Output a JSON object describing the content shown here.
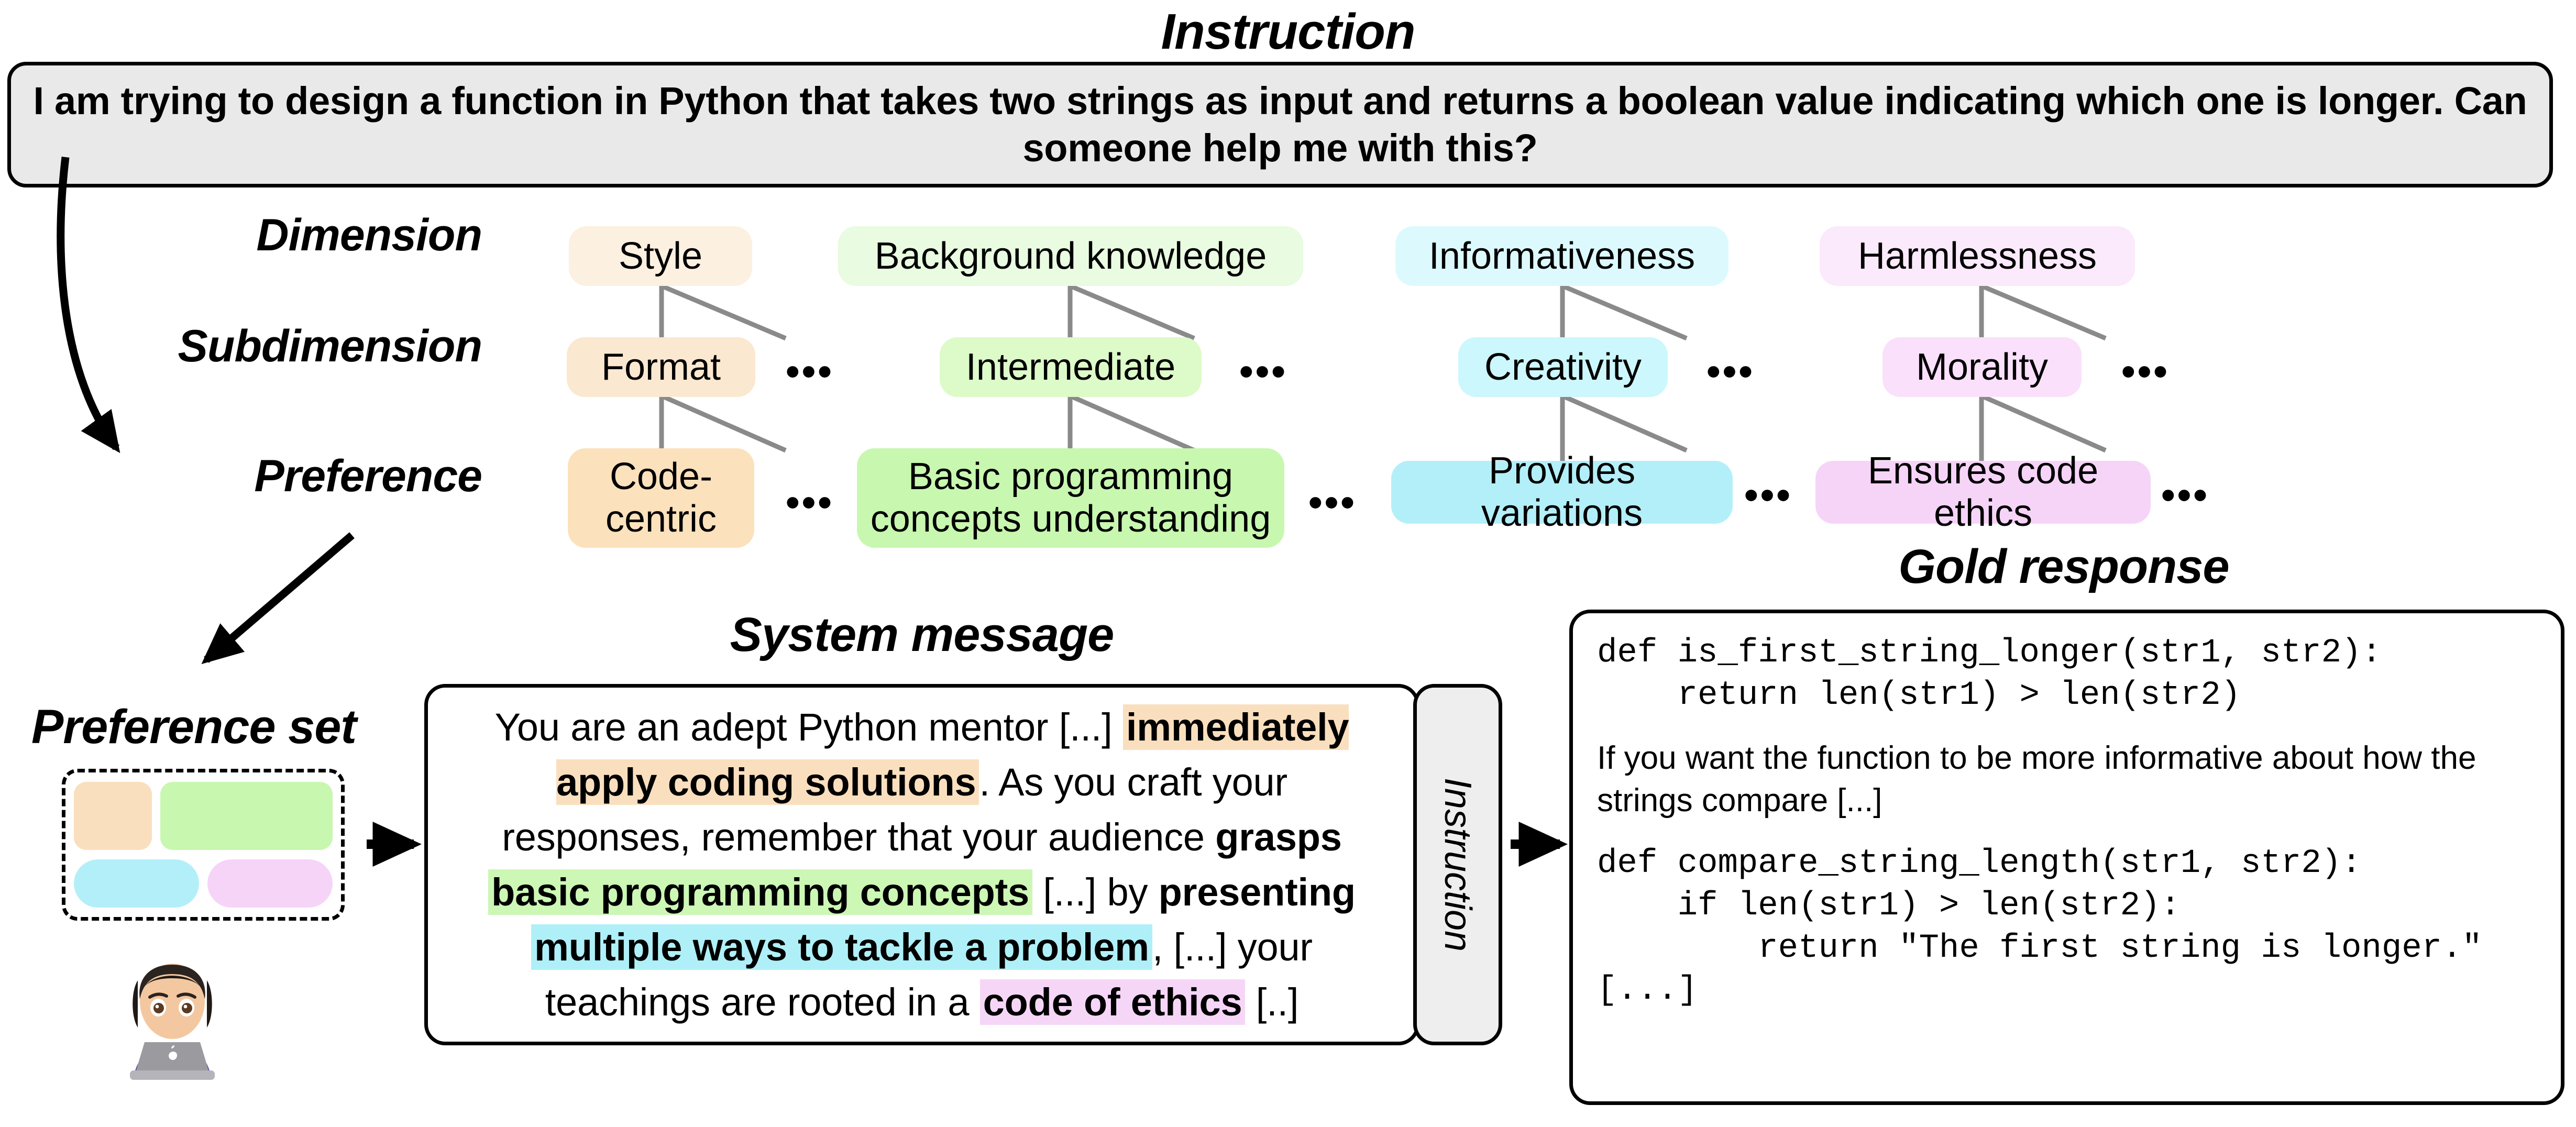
{
  "titles": {
    "instruction": "Instruction",
    "system_message": "System message",
    "gold_response": "Gold response",
    "preference_set": "Preference set"
  },
  "row_labels": {
    "dimension": "Dimension",
    "subdimension": "Subdimension",
    "preference": "Preference"
  },
  "instruction": {
    "text": "I am trying to design a function in Python that takes two strings as input and returns a boolean value indicating which one is longer. Can someone help me with this?"
  },
  "taxonomy": {
    "ellipsis": "•••",
    "columns": [
      {
        "key": "style",
        "color_dimension": "#fcf0e1",
        "color_subdimension": "#fbe8d0",
        "color_preference": "#fbe1bc",
        "dimension": "Style",
        "subdimension": "Format",
        "preference": "Code-\ncentric"
      },
      {
        "key": "background-knowledge",
        "color_dimension": "#e9fbe0",
        "color_subdimension": "#ddfac9",
        "color_preference": "#c8f7b0",
        "dimension": "Background knowledge",
        "subdimension": "Intermediate",
        "preference": "Basic programming\nconcepts understanding"
      },
      {
        "key": "informativeness",
        "color_dimension": "#dcfafd",
        "color_subdimension": "#ccf7fc",
        "color_preference": "#b3eff9",
        "dimension": "Informativeness",
        "subdimension": "Creativity",
        "preference": "Provides variations"
      },
      {
        "key": "harmlessness",
        "color_dimension": "#fbeafb",
        "color_subdimension": "#fae0fb",
        "color_preference": "#f6d4f8",
        "dimension": "Harmlessness",
        "subdimension": "Morality",
        "preference": "Ensures code ethics"
      }
    ]
  },
  "system_message": {
    "segments": [
      {
        "text": "You are an adept Python mentor [...] ",
        "style": "plain"
      },
      {
        "text": "immediately apply coding solutions",
        "style": "highlight-orange"
      },
      {
        "text": ". As you craft your responses, remember that your audience ",
        "style": "plain"
      },
      {
        "text": "grasps",
        "style": "bold"
      },
      {
        "text": " ",
        "style": "plain"
      },
      {
        "text": "basic programming concepts",
        "style": "highlight-green"
      },
      {
        "text": " [...] by ",
        "style": "plain"
      },
      {
        "text": "presenting",
        "style": "bold"
      },
      {
        "text": " ",
        "style": "plain"
      },
      {
        "text": "multiple ways to tackle a problem",
        "style": "highlight-cyan"
      },
      {
        "text": ", [...] your teachings are rooted in a ",
        "style": "plain"
      },
      {
        "text": "code of ethics",
        "style": "highlight-pink"
      },
      {
        "text": " [..]",
        "style": "plain"
      }
    ]
  },
  "instruction_chip": {
    "label": "Instruction"
  },
  "gold_response": {
    "blocks": [
      {
        "kind": "code",
        "text": "def is_first_string_longer(str1, str2):\n    return len(str1) > len(str2)"
      },
      {
        "kind": "gap",
        "text": ""
      },
      {
        "kind": "prose",
        "text": "If you want the function to be more informative about how the strings compare  [...]"
      },
      {
        "kind": "gap",
        "text": ""
      },
      {
        "kind": "code",
        "text": "def compare_string_length(str1, str2):\n    if len(str1) > len(str2):\n        return \"The first string is longer.\"\n[...]"
      }
    ]
  },
  "preference_set": {
    "chips": [
      {
        "name": "style-chip",
        "color": "#fadfbe"
      },
      {
        "name": "background-knowledge-chip",
        "color": "#c8f7b0"
      },
      {
        "name": "informativeness-chip",
        "color": "#b3eff9"
      },
      {
        "name": "harmlessness-chip",
        "color": "#f6d4f8"
      }
    ],
    "avatar": "woman-technologist-emoji"
  },
  "colors": {
    "instruction_banner_bg": "#e9e9e9",
    "connector_gray": "#8a8a8a",
    "border_black": "#000000"
  }
}
